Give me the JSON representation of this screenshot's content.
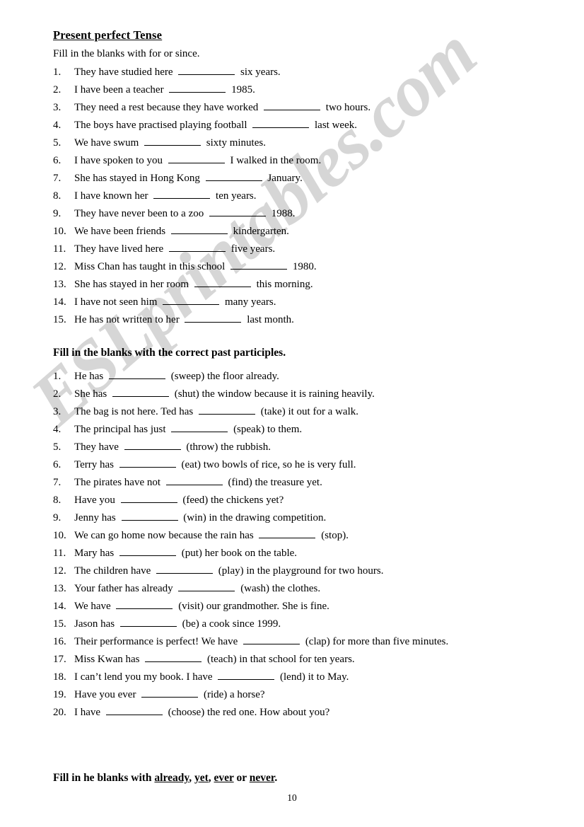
{
  "document": {
    "title": "Present perfect Tense",
    "page_number": "10",
    "watermark": "ESLprintables.com",
    "watermark_color": "#d6d6d6"
  },
  "section1": {
    "instruction": "Fill in the blanks with for or since.",
    "items": [
      {
        "num": "1.",
        "before": "They have studied here",
        "after": "six years."
      },
      {
        "num": "2.",
        "before": "I have been a teacher",
        "after": "1985."
      },
      {
        "num": "3.",
        "before": "They need a rest because they have worked",
        "after": "two hours."
      },
      {
        "num": "4.",
        "before": "The boys have practised playing football",
        "after": "last week."
      },
      {
        "num": "5.",
        "before": "We have swum",
        "after": "sixty minutes."
      },
      {
        "num": "6.",
        "before": "I have spoken to you",
        "after": "I walked in the room."
      },
      {
        "num": "7.",
        "before": "She has stayed in Hong Kong",
        "after": "January."
      },
      {
        "num": "8.",
        "before": "I have known her",
        "after": "ten years."
      },
      {
        "num": "9.",
        "before": "They have never been to a zoo",
        "after": "1988."
      },
      {
        "num": "10.",
        "before": "We have been friends",
        "after": "kindergarten."
      },
      {
        "num": "11.",
        "before": "They have lived here",
        "after": "five years."
      },
      {
        "num": "12.",
        "before": "Miss Chan has taught in this school",
        "after": "1980."
      },
      {
        "num": "13.",
        "before": "She has stayed in her room",
        "after": "this morning."
      },
      {
        "num": "14.",
        "before": "I have not seen him",
        "after": "many years."
      },
      {
        "num": "15.",
        "before": "He has not written to her",
        "after": "last month."
      }
    ]
  },
  "section2": {
    "heading": "Fill in the blanks with the correct past participles.",
    "items": [
      {
        "num": "1.",
        "before": "He has",
        "after": "(sweep) the floor already."
      },
      {
        "num": "2.",
        "before": "She has",
        "after": "(shut) the window because it is raining heavily."
      },
      {
        "num": "3.",
        "before": "The bag is not here. Ted has",
        "after": "(take) it out for a walk."
      },
      {
        "num": "4.",
        "before": "The principal has just",
        "after": "(speak) to them."
      },
      {
        "num": "5.",
        "before": "They have",
        "after": "(throw) the rubbish."
      },
      {
        "num": "6.",
        "before": "Terry has",
        "after": "(eat) two bowls of rice, so he is very full."
      },
      {
        "num": "7.",
        "before": "The pirates have not",
        "after": "(find) the treasure yet."
      },
      {
        "num": "8.",
        "before": "Have you",
        "after": "(feed) the chickens yet?"
      },
      {
        "num": "9.",
        "before": "Jenny has",
        "after": "(win) in the drawing competition."
      },
      {
        "num": "10.",
        "before": "We can go home now because the rain has",
        "after": "(stop)."
      },
      {
        "num": "11.",
        "before": "Mary has",
        "after": "(put) her book on the table."
      },
      {
        "num": "12.",
        "before": "The children have",
        "after": "(play) in the playground for two hours."
      },
      {
        "num": "13.",
        "before": "Your father has already",
        "after": "(wash) the clothes."
      },
      {
        "num": "14.",
        "before": "We have",
        "after": "(visit) our grandmother. She is fine."
      },
      {
        "num": "15.",
        "before": "Jason has",
        "after": "(be) a cook since 1999."
      },
      {
        "num": "16.",
        "before": "Their performance is perfect! We have",
        "after": "(clap) for more than five minutes."
      },
      {
        "num": "17.",
        "before": "Miss Kwan has",
        "after": "(teach) in that school for ten years."
      },
      {
        "num": "18.",
        "before": "I can’t lend you my book.   I have",
        "after": "(lend) it to May."
      },
      {
        "num": "19.",
        "before": "Have you ever",
        "after": "(ride) a horse?"
      },
      {
        "num": "20.",
        "before": "I have",
        "after": "(choose) the red one. How about you?"
      }
    ]
  },
  "section3": {
    "heading_part1": "Fill in he blanks with ",
    "word1": "already",
    "sep1": ", ",
    "word2": "yet",
    "sep2": ", ",
    "word3": "ever",
    "sep3": " or ",
    "word4": "never",
    "heading_end": "."
  }
}
